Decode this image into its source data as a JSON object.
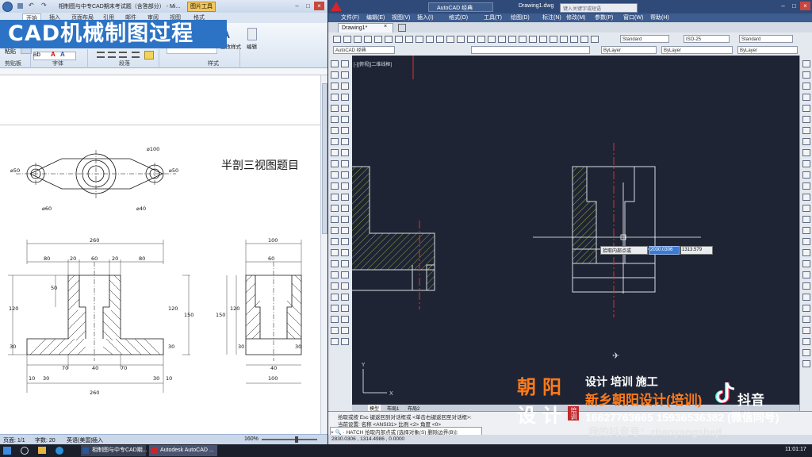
{
  "word": {
    "title": "相制图与中专CAD期末考试题（含答部分）  -  Mi...",
    "context_tab": "图片工具",
    "tabs": [
      "开始",
      "插入",
      "页面布局",
      "引用",
      "邮件",
      "审阅",
      "视图",
      "格式"
    ],
    "groups": [
      "剪贴板",
      "字体",
      "段落",
      "样式",
      "编辑"
    ],
    "paste_label": "粘贴",
    "style_label": "样式",
    "change_style_label": "更改样式",
    "edit_label": "编辑",
    "overlay_title": "CAD机械制图过程",
    "doc_heading": "半剖三视图题目",
    "status": {
      "page": "页面: 1/1",
      "words": "字数: 20",
      "lang": "英语(美国)",
      "mode": "插入",
      "zoom": "160%"
    },
    "top_view": {
      "labels": [
        "⌀100",
        "⌀50",
        "⌀50",
        "⌀60",
        "⌀40"
      ]
    },
    "front_view": {
      "dims_top": [
        "260",
        "80",
        "20",
        "60",
        "20",
        "80"
      ],
      "dims_bottom": [
        "70",
        "40",
        "70",
        "10",
        "30",
        "30",
        "10",
        "260"
      ],
      "dims_side": [
        "50",
        "120",
        "30",
        "150",
        "120",
        "30"
      ]
    },
    "side_view": {
      "dims": [
        "100",
        "60",
        "120",
        "150",
        "30",
        "30",
        "40",
        "100"
      ]
    }
  },
  "acad": {
    "title": "Drawing1.dwg",
    "workspace": "AutoCAD 经典",
    "search_placeholder": "键入关键字或短语",
    "menu": [
      "文件(F)",
      "编辑(E)",
      "视图(V)",
      "插入(I)",
      "格式(O)",
      "工具(T)",
      "绘图(D)",
      "标注(N)",
      "修改(M)",
      "参数(P)",
      "窗口(W)",
      "帮助(H)"
    ],
    "doc_tab": "Drawing1*",
    "style_combos": [
      "Standard",
      "ISO-25",
      "Standard"
    ],
    "workspace_combo": "AutoCAD 经典",
    "layer_combos": [
      "ByLayer",
      "ByLayer",
      "ByLayer"
    ],
    "viewport_label": "[-][俯视][二维线框]",
    "model_tabs": [
      "模型",
      "布局1",
      "布局2"
    ],
    "tooltip": {
      "label": "拾取内部点或",
      "x_value": "2030.0306",
      "y_value": "1313.579"
    },
    "command_lines": [
      "拾取或按 Esc 键返回到对话框或 <单击右键返回至对话框>:",
      "当前设置: 名称 <ANSI31>  比例 <2>  角度 <0>",
      "× 🔍 · HATCH 拾取内部点或 [选择对象(S) 删除边界(B)]:"
    ],
    "status_coords": "2830.0306 , 1314.4986 , 0.0000"
  },
  "watermark": {
    "logo_chars": [
      "朝",
      "阳",
      "设",
      "计"
    ],
    "badge": "培训",
    "services": "设计  培训  施工",
    "company": "新乡朝阳设计(培训)",
    "douyin": "抖音",
    "phone": "16627763665    15936536382 (微信同号)",
    "account": "我的抖音号：zhaoyangshejf"
  },
  "taskbar": {
    "items": [
      "相制图与中专CAD期...",
      "Autodesk AutoCAD ..."
    ],
    "time": "11:01:17"
  },
  "colors": {
    "brand_blue": "#2c73c5",
    "canvas_bg": "#1e2433",
    "hatch": "#b5c24a",
    "center_line": "#e03030",
    "watermark_orange": "#ff7a18"
  }
}
